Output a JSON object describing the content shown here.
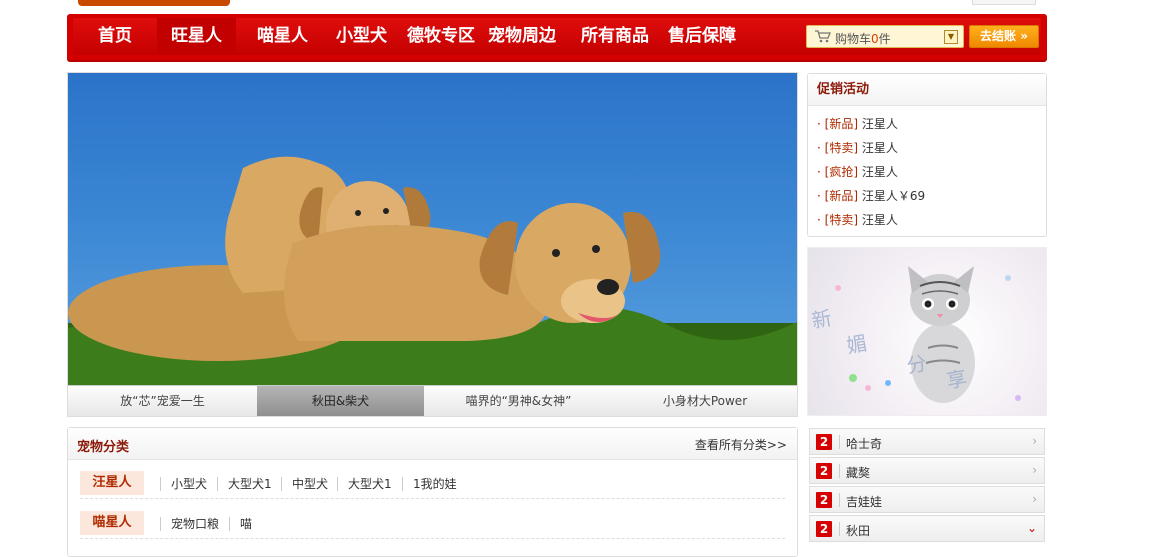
{
  "nav": {
    "items": [
      {
        "label": "首页"
      },
      {
        "label": "旺星人"
      },
      {
        "label": "喵星人"
      },
      {
        "label": "小型犬"
      },
      {
        "label": "德牧专区"
      },
      {
        "label": "宠物周边"
      },
      {
        "label": "所有商品"
      },
      {
        "label": "售后保障"
      }
    ],
    "active_index": 1
  },
  "cart": {
    "prefix": "购物车",
    "count": "0",
    "suffix": "件",
    "checkout_label": "去结账 »"
  },
  "banner": {
    "tabs": [
      {
        "label": "放“芯”宠爱一生"
      },
      {
        "label": "秋田&柴犬"
      },
      {
        "label": "喵界的“男神&女神”"
      },
      {
        "label": "小身材大Power"
      }
    ],
    "selected_tab": 1
  },
  "promo": {
    "title": "促销活动",
    "items": [
      {
        "tag": "[新品]",
        "text": " 汪星人"
      },
      {
        "tag": "[特卖]",
        "text": " 汪星人"
      },
      {
        "tag": "[疯抢]",
        "text": " 汪星人"
      },
      {
        "tag": "[新品]",
        "text": " 汪星人￥69"
      },
      {
        "tag": "[特卖]",
        "text": " 汪星人"
      }
    ]
  },
  "category": {
    "title": "宠物分类",
    "more_link": "查看所有分类>>",
    "rows": [
      {
        "label": "汪星人",
        "links": [
          "小型犬",
          "大型犬1",
          "中型犬",
          "大型犬1",
          "1我的娃"
        ]
      },
      {
        "label": "喵星人",
        "links": [
          "宠物口粮",
          "喵"
        ]
      }
    ]
  },
  "ranking": {
    "items": [
      {
        "rank": "2",
        "label": "哈士奇",
        "expanded": false
      },
      {
        "rank": "2",
        "label": "藏獒",
        "expanded": false
      },
      {
        "rank": "2",
        "label": "吉娃娃",
        "expanded": false
      },
      {
        "rank": "2",
        "label": "秋田",
        "expanded": true
      }
    ]
  },
  "colors": {
    "brand_red": "#d40000",
    "accent_orange": "#f08800",
    "tag_red": "#b02a00"
  }
}
